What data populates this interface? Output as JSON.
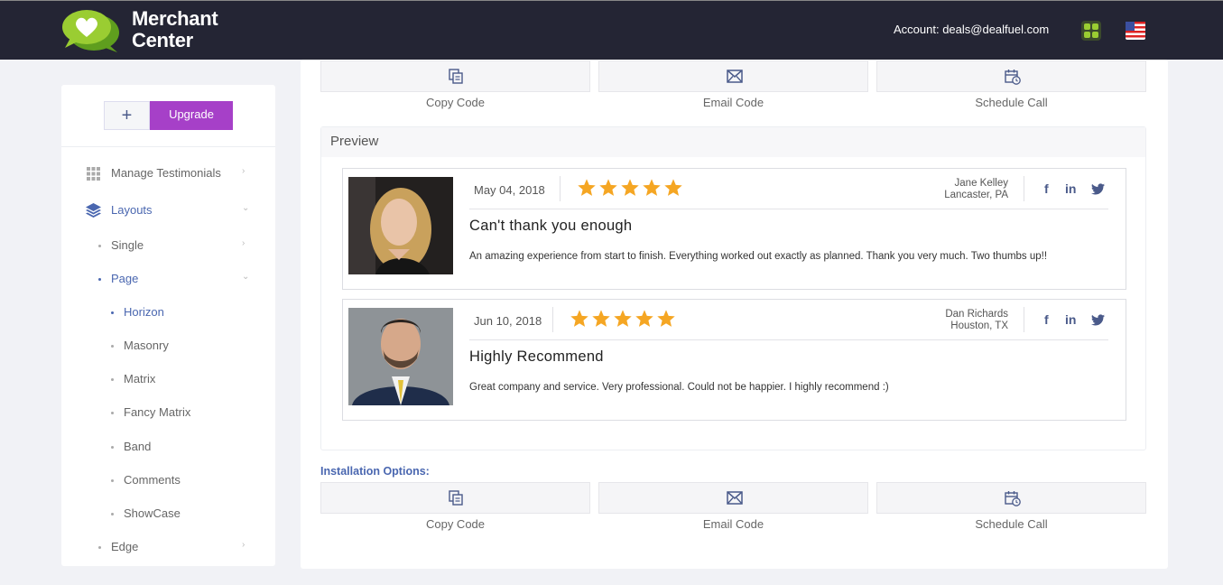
{
  "header": {
    "brand_line1": "Merchant",
    "brand_line2": "Center",
    "account": "Account: deals@dealfuel.com",
    "logo_icon": "heart-chat-logo",
    "apps_icon": "apps-grid-icon",
    "flag_icon": "us-flag-icon"
  },
  "sidebar": {
    "plus_label": "+",
    "upgrade_label": "Upgrade",
    "items": [
      {
        "label": "Manage Testimonials",
        "icon": "grid-icon"
      },
      {
        "label": "Layouts",
        "icon": "layers-icon"
      },
      {
        "label": "Single"
      },
      {
        "label": "Page"
      },
      {
        "label": "Horizon"
      },
      {
        "label": "Masonry"
      },
      {
        "label": "Matrix"
      },
      {
        "label": "Fancy Matrix"
      },
      {
        "label": "Band"
      },
      {
        "label": "Comments"
      },
      {
        "label": "ShowCase"
      },
      {
        "label": "Edge"
      }
    ]
  },
  "options_top": {
    "copy": "Copy Code",
    "email": "Email Code",
    "schedule": "Schedule Call"
  },
  "preview": {
    "title": "Preview",
    "testimonials": [
      {
        "date": "May 04, 2018",
        "rating": 5,
        "name": "Jane Kelley",
        "location": "Lancaster, PA",
        "title": "Can't thank you enough",
        "body": "An amazing experience from start to finish. Everything worked out exactly as planned. Thank you very much. Two thumbs up!!"
      },
      {
        "date": "Jun 10, 2018",
        "rating": 5,
        "name": "Dan Richards",
        "location": "Houston, TX",
        "title": "Highly Recommend",
        "body": "Great company and service.  Very professional.  Could not be happier.  I highly recommend :)"
      }
    ],
    "social": {
      "facebook": "f",
      "linkedin": "in"
    }
  },
  "installation": {
    "label": "Installation Options:",
    "copy": "Copy Code",
    "email": "Email Code",
    "schedule": "Schedule Call"
  },
  "colors": {
    "header_bg": "#242534",
    "accent": "#4a67b0",
    "upgrade": "#a640c8",
    "star": "#f5a623"
  }
}
